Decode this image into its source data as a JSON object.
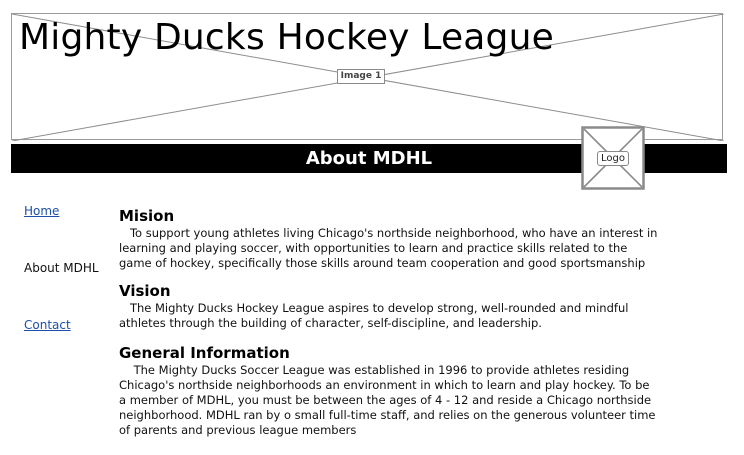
{
  "header": {
    "site_title": "Mighty Ducks Hockey League",
    "image_placeholder_label": "Image 1",
    "page_title": "About MDHL",
    "logo_label": "Logo"
  },
  "nav": {
    "items": [
      {
        "label": "Home",
        "link": true
      },
      {
        "label": "About MDHL",
        "link": false
      },
      {
        "label": "Contact",
        "link": true
      }
    ]
  },
  "sections": [
    {
      "title": "Mision",
      "body": "   To support young athletes living Chicago's northside neighborhood, who have an interest in learning and playing soccer, with opportunities to learn and practice skills related to the game of hockey, specifically those skills around team cooperation and good sportsmanship"
    },
    {
      "title": "Vision",
      "body": "   The Mighty Ducks Hockey League aspires to develop strong, well-rounded and mindful athletes through the building of character, self-discipline, and leadership."
    },
    {
      "title": "General Information",
      "body": "    The Mighty Ducks Soccer League was established in 1996 to provide athletes residing Chicago's northside neighborhoods an environment in which to learn and play hockey. To be a member of MDHL, you must be between the ages of 4 - 12 and reside a Chicago northside neighborhood. MDHL ran by o small full-time staff, and relies on the generous volunteer time of parents and previous league members"
    }
  ]
}
